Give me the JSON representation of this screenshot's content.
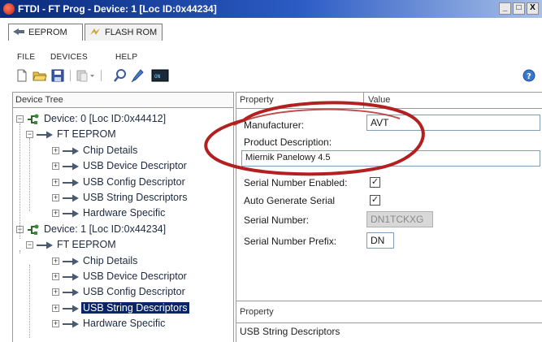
{
  "window": {
    "title": "FTDI - FT Prog - Device: 1 [Loc ID:0x44234]",
    "controls": [
      "_",
      "□",
      "X"
    ]
  },
  "tabs": [
    {
      "label": "EEPROM",
      "icon": "eeprom-tab-icon",
      "active": true
    },
    {
      "label": "FLASH ROM",
      "icon": "flash-rom-tab-icon",
      "active": false
    }
  ],
  "menu": [
    "FILE",
    "DEVICES",
    "HELP"
  ],
  "toolbar": {
    "icons": [
      "new-file-icon",
      "open-folder-icon",
      "save-icon",
      "paste-dropdown-icon",
      "search-icon",
      "program-device-icon",
      "cycle-ports-icon",
      "help-icon"
    ]
  },
  "device_tree": {
    "header": "Device Tree",
    "nodes": [
      {
        "label": "Device: 0 [Loc ID:0x44412]",
        "level": 0,
        "expander": "−",
        "kind": "device"
      },
      {
        "label": "FT EEPROM",
        "level": 1,
        "expander": "−",
        "kind": "section"
      },
      {
        "label": "Chip Details",
        "level": 2,
        "expander": "+",
        "kind": "item"
      },
      {
        "label": "USB Device Descriptor",
        "level": 2,
        "expander": "+",
        "kind": "item"
      },
      {
        "label": "USB Config Descriptor",
        "level": 2,
        "expander": "+",
        "kind": "item"
      },
      {
        "label": "USB String Descriptors",
        "level": 2,
        "expander": "+",
        "kind": "item"
      },
      {
        "label": "Hardware Specific",
        "level": 2,
        "expander": "+",
        "kind": "item"
      },
      {
        "label": "Device: 1 [Loc ID:0x44234]",
        "level": 0,
        "expander": "−",
        "kind": "device"
      },
      {
        "label": "FT EEPROM",
        "level": 1,
        "expander": "−",
        "kind": "section"
      },
      {
        "label": "Chip Details",
        "level": 2,
        "expander": "+",
        "kind": "item"
      },
      {
        "label": "USB Device Descriptor",
        "level": 2,
        "expander": "+",
        "kind": "item"
      },
      {
        "label": "USB Config Descriptor",
        "level": 2,
        "expander": "+",
        "kind": "item"
      },
      {
        "label": "USB String Descriptors",
        "level": 2,
        "expander": "+",
        "kind": "item",
        "selected": true
      },
      {
        "label": "Hardware Specific",
        "level": 2,
        "expander": "+",
        "kind": "item"
      }
    ]
  },
  "property_grid": {
    "col_property": "Property",
    "col_value": "Value",
    "manufacturer": {
      "label": "Manufacturer:",
      "value": "AVT"
    },
    "product_description": {
      "label": "Product Description:",
      "value": "Miernik Panelowy 4.5"
    },
    "serial_number_enabled": {
      "label": "Serial Number Enabled:",
      "checked": true
    },
    "auto_generate_serial": {
      "label": "Auto Generate Serial",
      "checked": true
    },
    "serial_number": {
      "label": "Serial Number:",
      "value": "DN1TCKXG",
      "disabled": true
    },
    "serial_number_prefix": {
      "label": "Serial Number Prefix:",
      "value": "DN"
    }
  },
  "description_box": {
    "header": "Property",
    "value": "USB String Descriptors"
  },
  "annotation": {
    "color": "#b32020"
  },
  "colors": {
    "selection": "#0a246a",
    "titlebar": "#0a2a7a"
  }
}
